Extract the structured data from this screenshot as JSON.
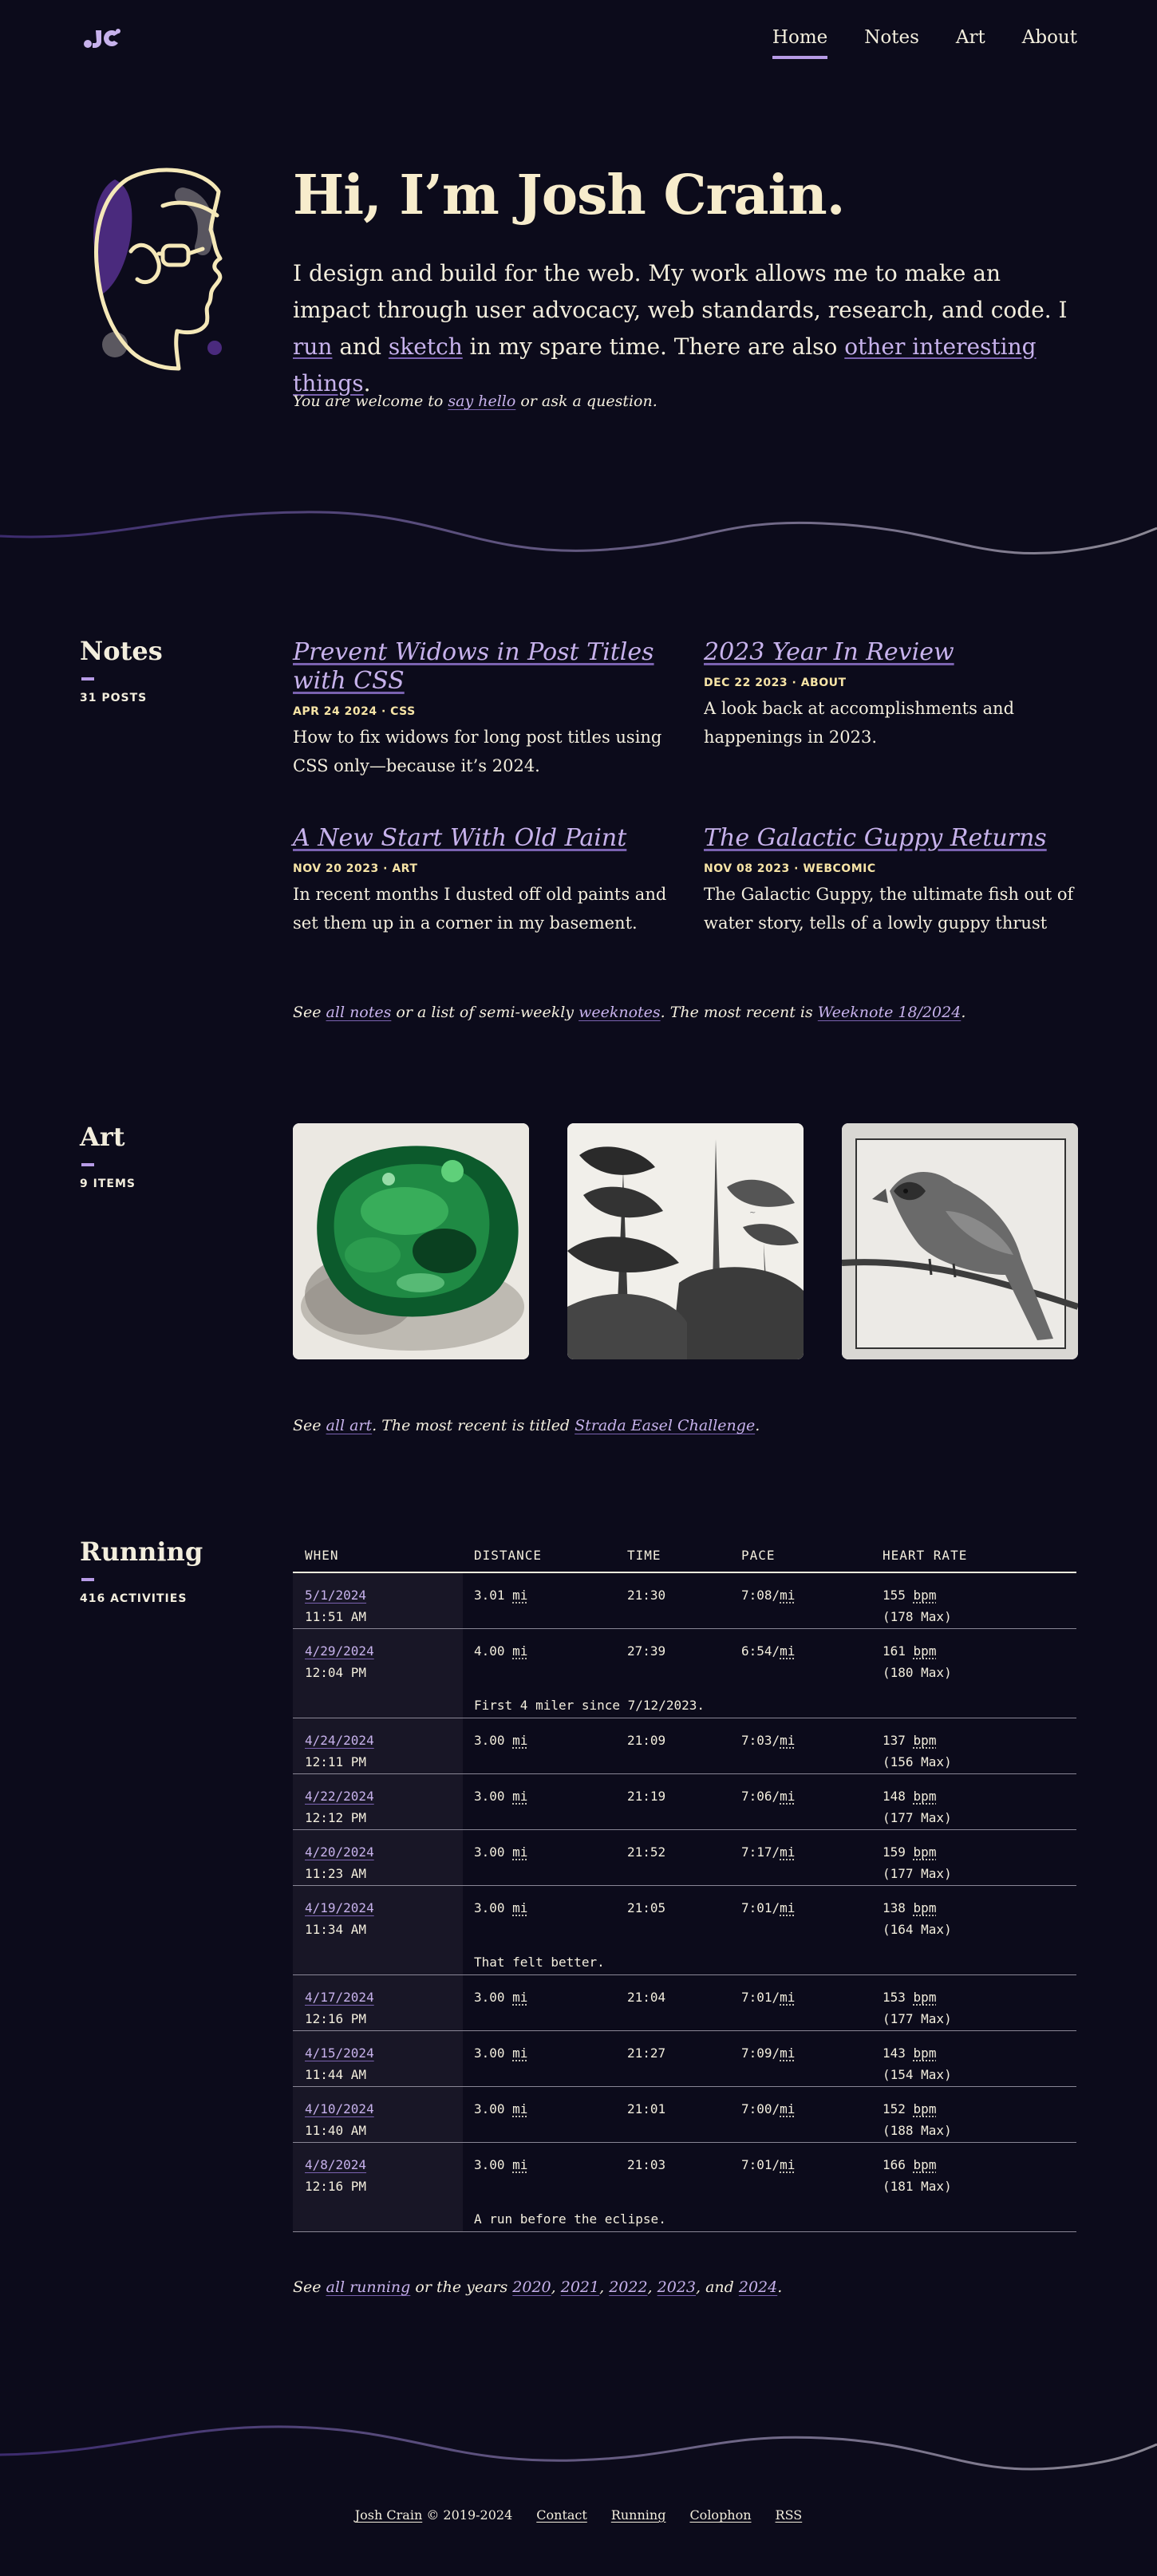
{
  "nav": {
    "logo_alt": "JC",
    "items": [
      "Home",
      "Notes",
      "Art",
      "About"
    ]
  },
  "hero": {
    "title": "Hi, I’m Josh Crain.",
    "intro_1": "I design and build for the web. My work allows me to make an impact through user advocacy, web standards, research, and code. I ",
    "run": "run",
    "and": " and ",
    "sketch": "sketch",
    "intro_2": " in my spare time. There are also ",
    "other": "other interesting things",
    "intro_end": ".",
    "note_1": "You are welcome to ",
    "say_hello": "say hello",
    "note_2": " or ask a question."
  },
  "notes": {
    "heading": "Notes",
    "count": "31 POSTS",
    "items": [
      {
        "title": "Prevent Widows in Post Titles with CSS",
        "meta": "APR 24 2024 · CSS",
        "desc": "How to fix widows for long post titles using CSS only—because it’s 2024."
      },
      {
        "title": "2023 Year In Review",
        "meta": "DEC 22 2023 · ABOUT",
        "desc": "A look back at accomplishments and happenings in 2023."
      },
      {
        "title": "A New Start With Old Paint",
        "meta": "NOV 20 2023 · ART",
        "desc": "In recent months I dusted off old paints and set them up in a corner in my basement."
      },
      {
        "title": "The Galactic Guppy Returns",
        "meta": "NOV 08 2023 · WEBCOMIC",
        "desc": "The Galactic Guppy, the ultimate fish out of water story, tells of a lowly guppy thrust into an i…"
      }
    ],
    "see_1": "See ",
    "all_notes": "all notes",
    "see_2": " or a list of semi-weekly ",
    "weeknotes": "weeknotes",
    "see_3": ". The most recent is ",
    "recent": "Weeknote 18/2024",
    "see_4": "."
  },
  "art": {
    "heading": "Art",
    "count": "9 ITEMS",
    "items": [
      "green-glass-painting",
      "tree-sketch",
      "cardinal-drawing"
    ],
    "see_1": "See ",
    "all_art": "all art",
    "see_2": ". The most recent is titled ",
    "recent": "Strada Easel Challenge",
    "see_3": "."
  },
  "running": {
    "heading": "Running",
    "count": "416 ACTIVITIES",
    "columns": [
      "WHEN",
      "DISTANCE",
      "TIME",
      "PACE",
      "HEART RATE"
    ],
    "unit_mi": "mi",
    "unit_bpm": "bpm",
    "rows": [
      {
        "date": "5/1/2024",
        "time_of_day": "11:51 AM",
        "distance": "3.01",
        "time": "21:30",
        "pace": "7:08/",
        "hr": "155",
        "max": "(178 Max)",
        "note": ""
      },
      {
        "date": "4/29/2024",
        "time_of_day": "12:04 PM",
        "distance": "4.00",
        "time": "27:39",
        "pace": "6:54/",
        "hr": "161",
        "max": "(180 Max)",
        "note": "First 4 miler since 7/12/2023."
      },
      {
        "date": "4/24/2024",
        "time_of_day": "12:11 PM",
        "distance": "3.00",
        "time": "21:09",
        "pace": "7:03/",
        "hr": "137",
        "max": "(156 Max)",
        "note": ""
      },
      {
        "date": "4/22/2024",
        "time_of_day": "12:12 PM",
        "distance": "3.00",
        "time": "21:19",
        "pace": "7:06/",
        "hr": "148",
        "max": "(177 Max)",
        "note": ""
      },
      {
        "date": "4/20/2024",
        "time_of_day": "11:23 AM",
        "distance": "3.00",
        "time": "21:52",
        "pace": "7:17/",
        "hr": "159",
        "max": "(177 Max)",
        "note": ""
      },
      {
        "date": "4/19/2024",
        "time_of_day": "11:34 AM",
        "distance": "3.00",
        "time": "21:05",
        "pace": "7:01/",
        "hr": "138",
        "max": "(164 Max)",
        "note": "That felt better."
      },
      {
        "date": "4/17/2024",
        "time_of_day": "12:16 PM",
        "distance": "3.00",
        "time": "21:04",
        "pace": "7:01/",
        "hr": "153",
        "max": "(177 Max)",
        "note": ""
      },
      {
        "date": "4/15/2024",
        "time_of_day": "11:44 AM",
        "distance": "3.00",
        "time": "21:27",
        "pace": "7:09/",
        "hr": "143",
        "max": "(154 Max)",
        "note": ""
      },
      {
        "date": "4/10/2024",
        "time_of_day": "11:40 AM",
        "distance": "3.00",
        "time": "21:01",
        "pace": "7:00/",
        "hr": "152",
        "max": "(188 Max)",
        "note": ""
      },
      {
        "date": "4/8/2024",
        "time_of_day": "12:16 PM",
        "distance": "3.00",
        "time": "21:03",
        "pace": "7:01/",
        "hr": "166",
        "max": "(181 Max)",
        "note": "A run before the eclipse."
      }
    ],
    "see_1": "See ",
    "all_running": "all running",
    "see_2": " or the years ",
    "years": [
      "2020",
      "2021",
      "2022",
      "2023",
      "2024"
    ],
    "sep": ", ",
    "and": ", and ",
    "end": "."
  },
  "footer": {
    "name": "Josh Crain",
    "copyright": " © 2019-2024",
    "links": [
      "Contact",
      "Running",
      "Colophon",
      "RSS"
    ]
  },
  "colors": {
    "background": "#0c0b1b",
    "accent": "#b79be6",
    "link": "#c7b2ec",
    "title": "#f7eccc",
    "meta": "#f7e4a6"
  }
}
